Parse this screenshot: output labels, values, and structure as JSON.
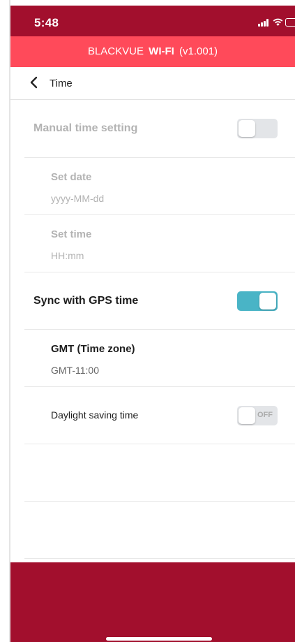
{
  "status_bar": {
    "time": "5:48"
  },
  "header": {
    "brand": "BLACKVUE",
    "product": "WI-FI",
    "version": "(v1.001)"
  },
  "nav": {
    "title": "Time"
  },
  "settings": {
    "manual_time": {
      "label": "Manual time setting",
      "toggle": "off"
    },
    "set_date": {
      "label": "Set date",
      "placeholder": "yyyy-MM-dd"
    },
    "set_time": {
      "label": "Set time",
      "placeholder": "HH:mm"
    },
    "gps_sync": {
      "label": "Sync with GPS time",
      "toggle": "on"
    },
    "timezone": {
      "label": "GMT (Time zone)",
      "value": "GMT-11:00"
    },
    "dst": {
      "label": "Daylight saving time",
      "toggle_text": "OFF"
    }
  },
  "colors": {
    "status_bar": "#a20f2d",
    "header": "#ff4a5a",
    "toggle_on": "#49b4c6",
    "toggle_off": "#e3e5e8"
  }
}
